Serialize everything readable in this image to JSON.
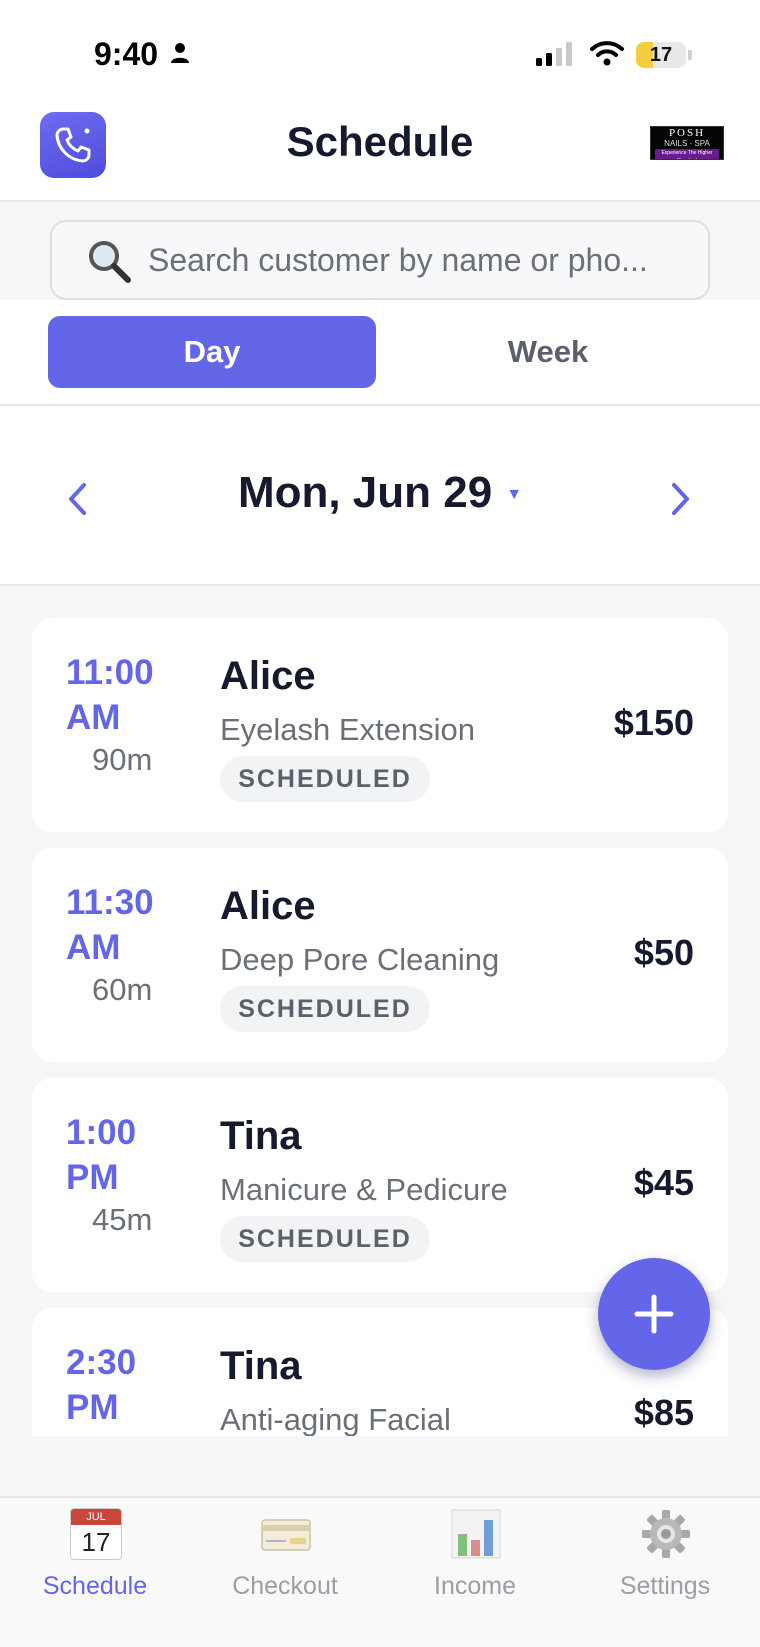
{
  "status_bar": {
    "time": "9:40",
    "battery": "17"
  },
  "header": {
    "title": "Schedule",
    "logo": {
      "line1": "POSH",
      "line2": "NAILS · SPA",
      "line3": "Experience The Higher Standard"
    }
  },
  "search": {
    "placeholder": "Search customer by name or pho..."
  },
  "view_toggle": {
    "day_label": "Day",
    "week_label": "Week",
    "selected": "Day"
  },
  "date_nav": {
    "date": "Mon, Jun 29",
    "caret": "▼"
  },
  "appointments": [
    {
      "time_hm": "11:00",
      "time_ampm": "AM",
      "duration": "90m",
      "name": "Alice",
      "service": "Eyelash Extension",
      "status": "SCHEDULED",
      "price": "$150"
    },
    {
      "time_hm": "11:30",
      "time_ampm": "AM",
      "duration": "60m",
      "name": "Alice",
      "service": "Deep Pore Cleaning",
      "status": "SCHEDULED",
      "price": "$50"
    },
    {
      "time_hm": "1:00",
      "time_ampm": "PM",
      "duration": "45m",
      "name": "Tina",
      "service": "Manicure & Pedicure",
      "status": "SCHEDULED",
      "price": "$45"
    },
    {
      "time_hm": "2:30",
      "time_ampm": "PM",
      "duration": "",
      "name": "Tina",
      "service": "Anti-aging Facial",
      "status": "",
      "price": "$85"
    }
  ],
  "tabbar": {
    "items": [
      {
        "label": "Schedule",
        "icon": "calendar-icon",
        "active": true,
        "cal_month": "JUL",
        "cal_day": "17"
      },
      {
        "label": "Checkout",
        "icon": "credit-card-icon",
        "active": false
      },
      {
        "label": "Income",
        "icon": "bar-chart-icon",
        "active": false
      },
      {
        "label": "Settings",
        "icon": "gear-icon",
        "active": false
      }
    ]
  },
  "colors": {
    "accent": "#6366e9",
    "text_primary": "#161a2e",
    "text_secondary": "#6b6f78"
  }
}
